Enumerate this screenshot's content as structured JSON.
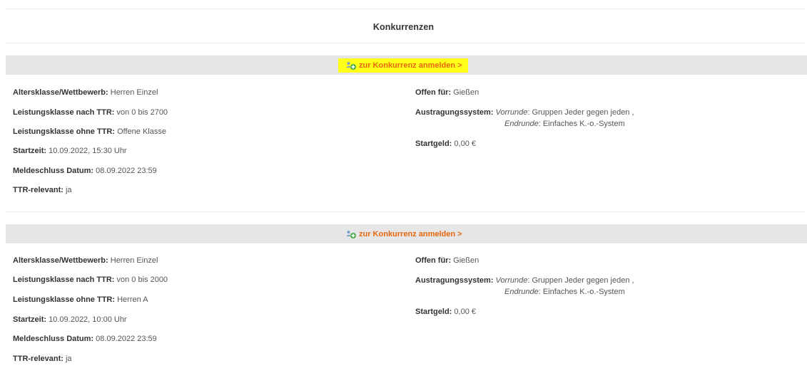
{
  "page": {
    "title": "Konkurrenzen"
  },
  "competitions": [
    {
      "register_label": "zur Konkurrenz anmelden >",
      "register_highlighted": true,
      "details": {
        "altersklasse": {
          "label": "Altersklasse/Wettbewerb:",
          "value": "Herren Einzel"
        },
        "lk_mit_ttr": {
          "label": "Leistungsklasse nach TTR:",
          "value": "von 0 bis 2700"
        },
        "lk_ohne_ttr": {
          "label": "Leistungsklasse ohne TTR:",
          "value": "Offene Klasse"
        },
        "startzeit": {
          "label": "Startzeit:",
          "value": "10.09.2022, 15:30 Uhr"
        },
        "meldeschluss": {
          "label": "Meldeschluss Datum:",
          "value": "08.09.2022 23:59"
        },
        "ttr_relevant": {
          "label": "TTR-relevant:",
          "value": "ja"
        },
        "offen_fuer": {
          "label": "Offen für:",
          "value": "Gießen"
        },
        "austragung": {
          "label": "Austragungssystem:",
          "vorrunde_label": "Vorrunde",
          "vorrunde_value": ": Gruppen Jeder gegen jeden ,",
          "endrunde_label": "Endrunde",
          "endrunde_value": ": Einfaches K.-o.-System"
        },
        "startgeld": {
          "label": "Startgeld:",
          "value": "0,00 €"
        }
      }
    },
    {
      "register_label": "zur Konkurrenz anmelden >",
      "register_highlighted": false,
      "details": {
        "altersklasse": {
          "label": "Altersklasse/Wettbewerb:",
          "value": "Herren Einzel"
        },
        "lk_mit_ttr": {
          "label": "Leistungsklasse nach TTR:",
          "value": "von 0 bis 2000"
        },
        "lk_ohne_ttr": {
          "label": "Leistungsklasse ohne TTR:",
          "value": "Herren A"
        },
        "startzeit": {
          "label": "Startzeit:",
          "value": "10.09.2022, 10:00 Uhr"
        },
        "meldeschluss": {
          "label": "Meldeschluss Datum:",
          "value": "08.09.2022 23:59"
        },
        "ttr_relevant": {
          "label": "TTR-relevant:",
          "value": "ja"
        },
        "offen_fuer": {
          "label": "Offen für:",
          "value": "Gießen"
        },
        "austragung": {
          "label": "Austragungssystem:",
          "vorrunde_label": "Vorrunde",
          "vorrunde_value": ": Gruppen Jeder gegen jeden ,",
          "endrunde_label": "Endrunde",
          "endrunde_value": ": Einfaches K.-o.-System"
        },
        "startgeld": {
          "label": "Startgeld:",
          "value": "0,00 €"
        }
      }
    }
  ],
  "colors": {
    "link": "#e8670c",
    "highlight": "#ffff1a",
    "bar": "#e6e6e6"
  },
  "icons": {
    "register": "add-user-icon"
  }
}
